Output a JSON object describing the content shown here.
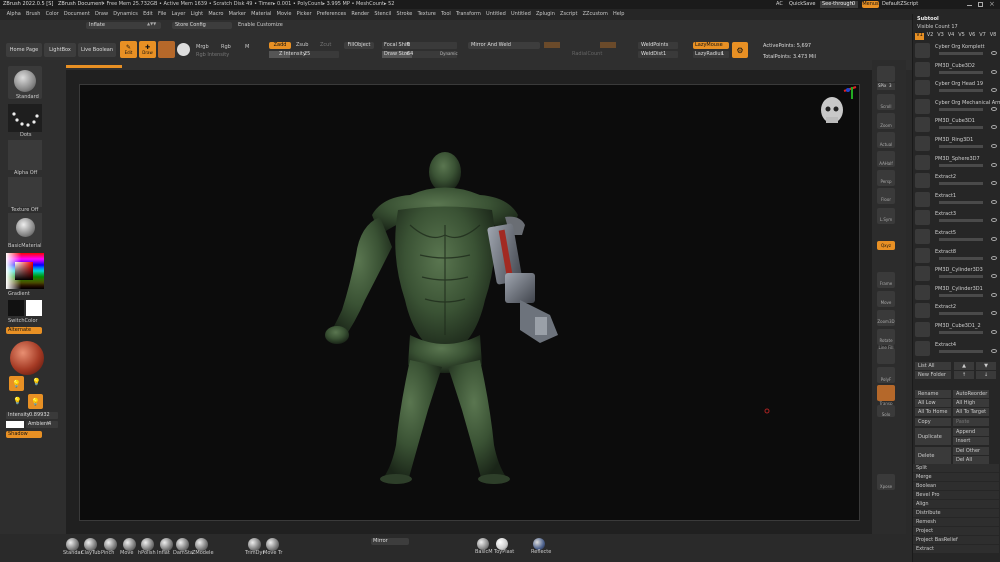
{
  "titlebar": {
    "app": "ZBrush 2022.0.5 [S]",
    "doc": "ZBrush Document",
    "stats": "• Free Mem 25.732GB • Active Mem 1639 • Scratch Disk 49 • Timer▸ 0.001 • PolyCount▸ 3.995 MP • MeshCount▸ 52",
    "ac": "AC",
    "quicksave": "QuickSave",
    "seethrough": "See-through",
    "seethrough_value": "0",
    "menus": "Menus",
    "script": "DefaultZScript"
  },
  "menubar": [
    "Alpha",
    "Brush",
    "Color",
    "Document",
    "Draw",
    "Dynamics",
    "Edit",
    "File",
    "Layer",
    "Light",
    "Macro",
    "Marker",
    "Material",
    "Movie",
    "Picker",
    "Preferences",
    "Render",
    "Stencil",
    "Stroke",
    "Texture",
    "Tool",
    "Transform",
    "Untitled",
    "Untitled",
    "Zplugin",
    "Zscript",
    "ZZcustom",
    "Help"
  ],
  "topshelf": {
    "inflate": "Inflate",
    "store_config": "Store Config",
    "enable_customize": "Enable Customize",
    "home_page": "Home Page",
    "lightbox": "LightBox",
    "live_boolean": "Live Boolean",
    "edit": "Edit",
    "draw": "Draw",
    "mrgb": "Mrgb",
    "rgb": "Rgb",
    "m": "M",
    "rgb_intensity": "Rgb Intensity",
    "zadd": "Zadd",
    "zsub": "Zsub",
    "zcut": "Zcut",
    "z_intensity_label": "Z Intensity",
    "z_intensity_value": "25",
    "fillobject": "FillObject",
    "focal_shift_label": "Focal Shift",
    "focal_shift_value": "0",
    "draw_size_label": "Draw Size",
    "draw_size_value": "64",
    "dynamic": "Dynamic",
    "mirror_and_weld": "Mirror And Weld",
    "radial_count": "RadialCount",
    "weld_points": "WeldPoints",
    "weld_dist_label": "WeldDist",
    "weld_dist_value": "1",
    "lazymouse": "LazyMouse",
    "lazyradius_label": "LazyRadius",
    "lazyradius_value": "1",
    "active_points": "ActivePoints: 5,697",
    "total_points": "TotalPoints: 3.473 Mil"
  },
  "leftshelf": {
    "standard": "Standard",
    "dots": "Dots",
    "alpha_off": "Alpha Off",
    "texture_off": "Texture Off",
    "basic_material": "BasicMaterial",
    "gradient": "Gradient",
    "switch_color": "SwitchColor",
    "alternate": "Alternate",
    "intensity_label": "Intensity",
    "intensity_value": "0.89932",
    "ambient_label": "Ambient",
    "ambient_value": "4",
    "shadow": "Shadow"
  },
  "rightshelf": {
    "spix_label": "SPix",
    "spix_value": "3",
    "scroll": "Scroll",
    "zoom": "Zoom",
    "actual": "Actual",
    "aahalf": "AAHalf",
    "persp": "Persp",
    "floor": "Floor",
    "lsym": "L.Sym",
    "xyz": "Qxyz",
    "frame": "Frame",
    "move": "Move",
    "zoom3d": "Zoom3D",
    "rotate": "Rotate",
    "linefill": "Line Fill",
    "polyf": "PolyF",
    "transp": "Transp",
    "ghost": "Ghost",
    "solo": "Solo",
    "xpose": "Xpose"
  },
  "subtool": {
    "title": "Subtool",
    "visible_count": "Visible Count 17",
    "tabs": [
      "V1",
      "V2",
      "V3",
      "V4",
      "V5",
      "V6",
      "V7",
      "V8"
    ],
    "items": [
      {
        "name": "Cyber Org Komplett"
      },
      {
        "name": "PM3D_Cube3D2"
      },
      {
        "name": "Cyber Org Head 19"
      },
      {
        "name": "Cyber Org Mechanical Arm"
      },
      {
        "name": "PM3D_Cube3D1"
      },
      {
        "name": "PM3D_Ring3D1"
      },
      {
        "name": "PM3D_Sphere3D7"
      },
      {
        "name": "Extract2"
      },
      {
        "name": "Extract1"
      },
      {
        "name": "Extract3"
      },
      {
        "name": "Extract5"
      },
      {
        "name": "Extract8"
      },
      {
        "name": "PM3D_Cylinder3D3"
      },
      {
        "name": "PM3D_Cylinder3D1"
      },
      {
        "name": "Extract2"
      },
      {
        "name": "PM3D_Cube3D1_2"
      },
      {
        "name": "Extract4"
      }
    ],
    "list_all": "List All",
    "new_folder": "New Folder",
    "rename": "Rename",
    "autoreorder": "AutoReorder",
    "all_low": "All Low",
    "all_high": "All High",
    "all_to_home": "All To Home",
    "all_to_target": "All To Target",
    "copy": "Copy",
    "paste": "Paste",
    "duplicate": "Duplicate",
    "append": "Append",
    "insert": "Insert",
    "delete": "Delete",
    "del_other": "Del Other",
    "del_all": "Del All",
    "split": "Split",
    "merge": "Merge",
    "boolean": "Boolean",
    "bevel_pro": "Bevel Pro",
    "align": "Align",
    "distribute": "Distribute",
    "remesh": "Remesh",
    "project": "Project",
    "project_basrelief": "Project BasRelief",
    "extract": "Extract"
  },
  "bottomshelf": {
    "brushes": [
      "Standar",
      "ClayTub",
      "Pinch",
      "Move",
      "hPolish",
      "Inflat",
      "DamSta",
      "ZModele",
      "TrimDyr",
      "Move Tr"
    ],
    "mirror": "Mirror",
    "basic_mat": "BasicM",
    "toyplast": "ToyPlast",
    "reflected": "Reflecte"
  },
  "colors": {
    "accent": "#e89024",
    "model_skin": "#3f5a3a",
    "background": "#0c0c0c"
  }
}
